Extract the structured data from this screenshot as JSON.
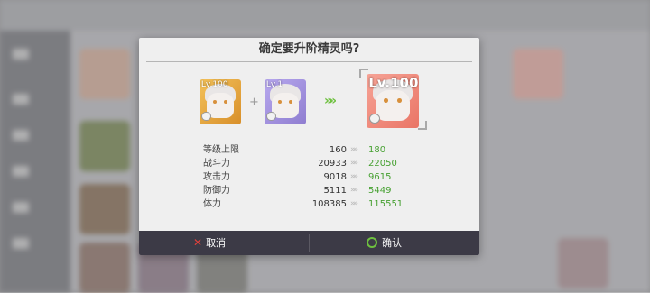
{
  "dialog": {
    "title": "确定要升阶精灵吗?",
    "material_card_1_level": "Lv.100",
    "material_card_2_level": "Lv.1",
    "result_card_level": "Lv.100",
    "plus_symbol": "+",
    "upgrade_arrows": "»»",
    "stats": [
      {
        "label": "等级上限",
        "old": "160",
        "new": "180"
      },
      {
        "label": "战斗力",
        "old": "20933",
        "new": "22050"
      },
      {
        "label": "攻击力",
        "old": "9018",
        "new": "9615"
      },
      {
        "label": "防御力",
        "old": "5111",
        "new": "5449"
      },
      {
        "label": "体力",
        "old": "108385",
        "new": "115551"
      }
    ],
    "cancel_label": "取消",
    "confirm_label": "确认"
  },
  "colors": {
    "gold_frame": "#e2a13a",
    "purple_frame": "#9b8ad8",
    "red_frame": "#f08477",
    "increase_green": "#45a030",
    "cancel_red": "#e0413b",
    "confirm_green": "#6ec03f",
    "footer_bg": "#3c3a46"
  },
  "icons": {
    "cancel": "close-x-icon",
    "confirm": "circle-ok-icon",
    "arrow": "double-chevron-right-icon"
  }
}
